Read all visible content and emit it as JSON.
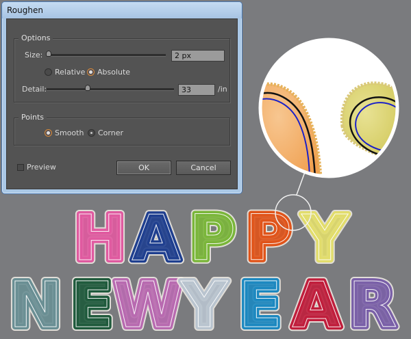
{
  "dialog": {
    "title": "Roughen",
    "options_legend": "Options",
    "size_label": "Size:",
    "size_value": "2 px",
    "relative_label": "Relative",
    "absolute_label": "Absolute",
    "detail_label": "Detail:",
    "detail_value": "33",
    "detail_unit": "/in",
    "points_legend": "Points",
    "smooth_label": "Smooth",
    "corner_label": "Corner",
    "preview_label": "Preview",
    "ok_label": "OK",
    "cancel_label": "Cancel",
    "size_slider_fraction": 0.03,
    "detail_slider_fraction": 0.33
  },
  "artwork": {
    "line1": [
      "H",
      "A",
      "P",
      "P",
      "Y"
    ],
    "line2": [
      "N",
      "E",
      "W",
      "Y",
      "E",
      "A",
      "R"
    ],
    "line1_colors": [
      "#e05aa0",
      "#1f3f8f",
      "#7ab63a",
      "#e0541a",
      "#e2dd6c"
    ],
    "line2_colors": [
      "#6a8f94",
      "#1f5a3c",
      "#b86ab0",
      "#b9c4cf",
      "#1c88c0",
      "#c01e3c",
      "#7a60a8"
    ],
    "zoom_orange": "#f0a860",
    "zoom_yellow": "#dcd36a",
    "path_blue": "#1a20c8"
  }
}
